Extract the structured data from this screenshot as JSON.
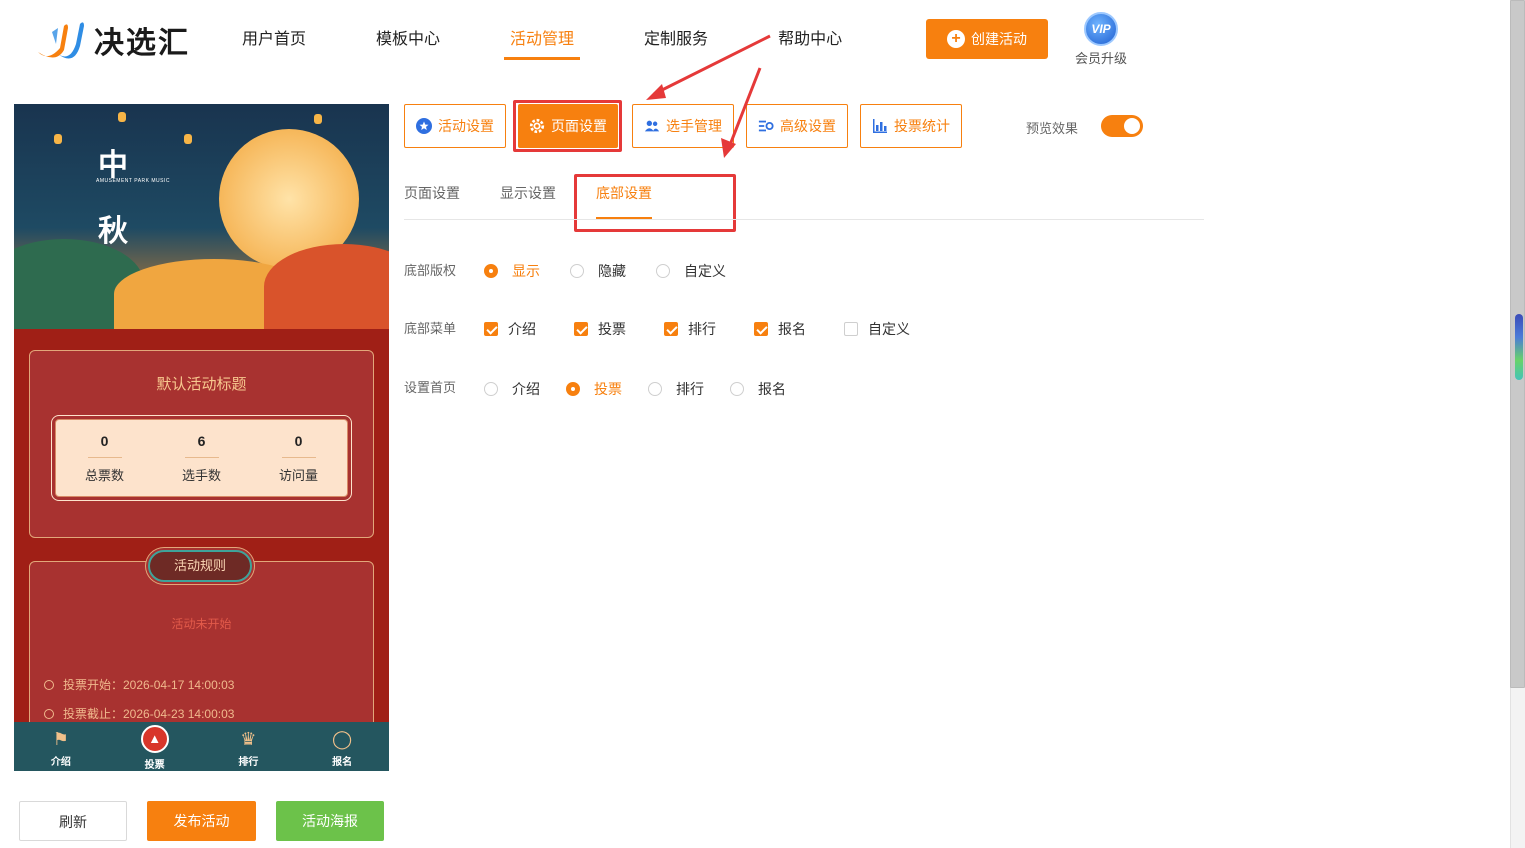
{
  "brand": {
    "name": "决选汇"
  },
  "nav": [
    {
      "label": "用户首页"
    },
    {
      "label": "模板中心"
    },
    {
      "label": "活动管理"
    },
    {
      "label": "定制服务"
    },
    {
      "label": "帮助中心"
    }
  ],
  "header": {
    "create_label": "创建活动",
    "vip_badge": "VIP",
    "vip_label": "会员升级"
  },
  "preview": {
    "banner_title_1": "中",
    "banner_title_2": "秋",
    "banner_sub": "AMUSEMENT PARK MUSIC",
    "activity_title": "默认活动标题",
    "stats": [
      {
        "value": "0",
        "label": "总票数"
      },
      {
        "value": "6",
        "label": "选手数"
      },
      {
        "value": "0",
        "label": "访问量"
      }
    ],
    "rules_title": "活动规则",
    "status": "活动未开始",
    "vote_start": "投票开始：2026-04-17 14:00:03",
    "vote_end": "投票截止：2026-04-23 14:00:03",
    "bottom_nav": [
      {
        "label": "介绍",
        "icon": "megaphone-icon"
      },
      {
        "label": "投票",
        "icon": "vote-icon"
      },
      {
        "label": "排行",
        "icon": "trophy-icon"
      },
      {
        "label": "报名",
        "icon": "signup-icon"
      }
    ]
  },
  "actions": {
    "refresh": "刷新",
    "publish": "发布活动",
    "poster": "活动海报"
  },
  "toolbar": {
    "buttons": [
      {
        "label": "活动设置",
        "icon": "star-icon"
      },
      {
        "label": "页面设置",
        "icon": "gear-icon"
      },
      {
        "label": "选手管理",
        "icon": "users-icon"
      },
      {
        "label": "高级设置",
        "icon": "sliders-icon"
      },
      {
        "label": "投票统计",
        "icon": "bar-chart-icon"
      }
    ],
    "active": "页面设置",
    "preview_label": "预览效果",
    "preview_on": true
  },
  "subtabs": [
    {
      "label": "页面设置"
    },
    {
      "label": "显示设置"
    },
    {
      "label": "底部设置"
    }
  ],
  "active_subtab": "底部设置",
  "form": {
    "copyright": {
      "label": "底部版权",
      "options": [
        "显示",
        "隐藏",
        "自定义"
      ],
      "selected": "显示"
    },
    "menu": {
      "label": "底部菜单",
      "options": [
        "介绍",
        "投票",
        "排行",
        "报名",
        "自定义"
      ],
      "checked": [
        "介绍",
        "投票",
        "排行",
        "报名"
      ]
    },
    "home": {
      "label": "设置首页",
      "options": [
        "介绍",
        "投票",
        "排行",
        "报名"
      ],
      "selected": "投票"
    }
  },
  "colors": {
    "accent": "#f7800f",
    "success": "#6cc24a",
    "highlight": "#e53939",
    "phone_bg": "#a01f16"
  }
}
